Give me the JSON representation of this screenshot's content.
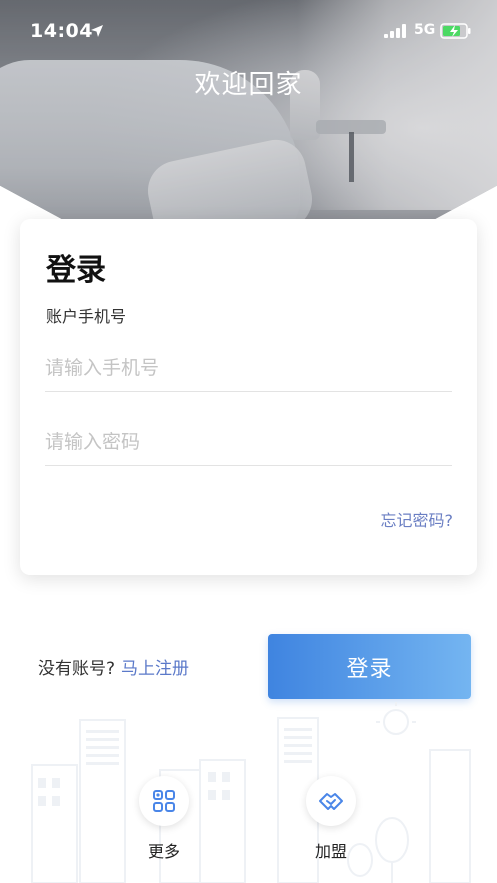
{
  "status_bar": {
    "time": "14:04",
    "network": "5G",
    "icons": [
      "location-arrow-icon",
      "signal-icon",
      "battery-charging-icon"
    ]
  },
  "header": {
    "welcome_title": "欢迎回家"
  },
  "login_card": {
    "title": "登录",
    "account_label": "账户手机号",
    "phone_placeholder": "请输入手机号",
    "phone_value": "",
    "password_placeholder": "请输入密码",
    "password_value": "",
    "forgot_password": "忘记密码?"
  },
  "register": {
    "prompt": "没有账号?",
    "link": "马上注册"
  },
  "login_button": {
    "label": "登录"
  },
  "bottom_actions": [
    {
      "label": "更多",
      "icon": "grid-apps-icon"
    },
    {
      "label": "加盟",
      "icon": "handshake-icon"
    }
  ],
  "colors": {
    "accent_link": "#5b79c9",
    "button_gradient_start": "#3f84e0",
    "button_gradient_end": "#74b5f1",
    "icon_blue": "#4a86e8"
  }
}
